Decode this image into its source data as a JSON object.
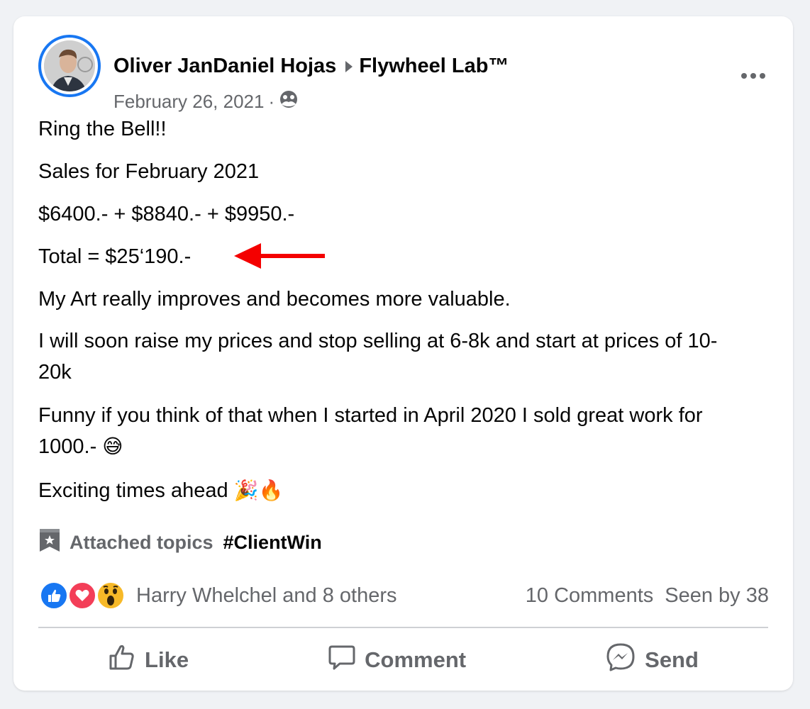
{
  "post": {
    "author": "Oliver JanDaniel Hojas",
    "group": "Flywheel Lab™",
    "date": "February 26, 2021",
    "separator": "·",
    "audience_icon": "group-icon",
    "more_icon": "more-options-icon"
  },
  "body": {
    "lines": [
      "Ring the Bell!!",
      "Sales for February 2021",
      "$6400.- + $8840.- + $9950.-",
      "Total = $25‘190.-",
      "My Art really improves and becomes more valuable.",
      "I will soon raise my prices and stop selling at 6-8k and start at prices of 10-20k",
      "Funny if you think of that when I started in April 2020 I sold great work for 1000.-",
      "Exciting times ahead"
    ],
    "emoji_sweat": "😅",
    "emoji_party": "🎉",
    "emoji_fire": "🔥",
    "annotation_color": "#f40000"
  },
  "topics": {
    "label": "Attached topics",
    "tag": "#ClientWin"
  },
  "reactions": {
    "summary": "Harry Whelchel and 8 others",
    "comments": "10 Comments",
    "seen": "Seen by 38",
    "icons": [
      "like-reaction-icon",
      "love-reaction-icon",
      "wow-reaction-icon"
    ]
  },
  "actions": {
    "like": "Like",
    "comment": "Comment",
    "send": "Send"
  },
  "colors": {
    "accent": "#1877f2",
    "secondary_text": "#65676b",
    "background": "#f0f2f5"
  }
}
